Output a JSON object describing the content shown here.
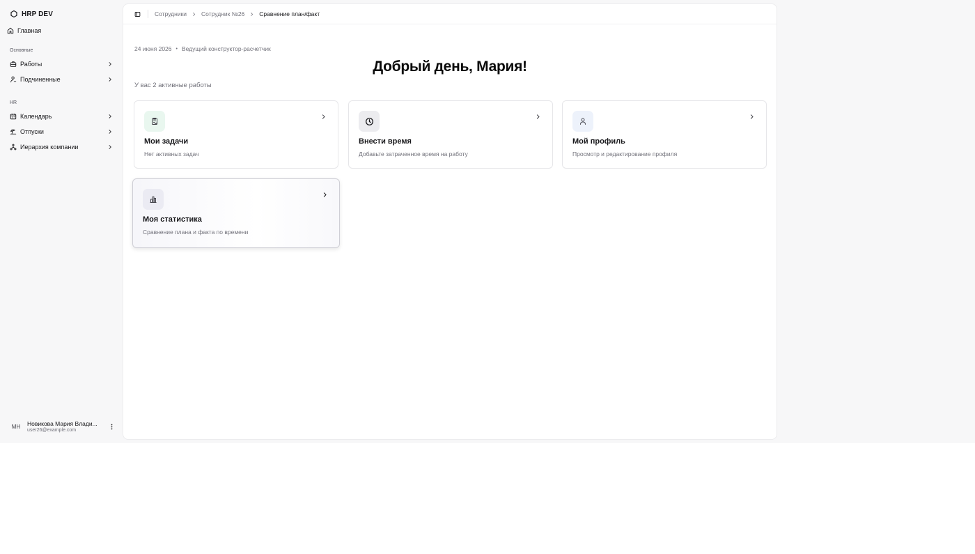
{
  "sidebar": {
    "brand": "HRP DEV",
    "home_label": "Главная",
    "sections": {
      "main_label": "Основные",
      "hr_label": "HR"
    },
    "items": [
      {
        "label": "Работы"
      },
      {
        "label": "Подчиненные"
      },
      {
        "label": "Календарь"
      },
      {
        "label": "Отпуски"
      },
      {
        "label": "Иерархия компании"
      }
    ],
    "user": {
      "initials": "МН",
      "name": "Новикова Мария Влади...",
      "email": "user26@example.com"
    }
  },
  "breadcrumb": {
    "items": [
      "Сотрудники",
      "Сотрудник №26"
    ],
    "current": "Сравнение план/факт"
  },
  "header": {
    "date": "24 июня 2026",
    "bullet": "•",
    "position": "Ведущий конструктор-расчетчик",
    "greeting": "Добрый день, Мария!",
    "active_works": "У вас 2 активные работы"
  },
  "cards": [
    {
      "title": "Мои задачи",
      "description": "Нет активных задач",
      "icon": "clipboard-check-icon",
      "icon_bg": "#e9f7ef"
    },
    {
      "title": "Внести время",
      "description": "Добавьте затраченное время на работу",
      "icon": "clock-icon",
      "icon_bg": "#ececef"
    },
    {
      "title": "Мой профиль",
      "description": "Просмотр и редактирование профиля",
      "icon": "user-icon",
      "icon_bg": "#edf2fb"
    },
    {
      "title": "Моя статистика",
      "description": "Сравнение плана и факта по времени",
      "icon": "bar-chart-icon",
      "icon_bg": "#ebebf3"
    }
  ]
}
